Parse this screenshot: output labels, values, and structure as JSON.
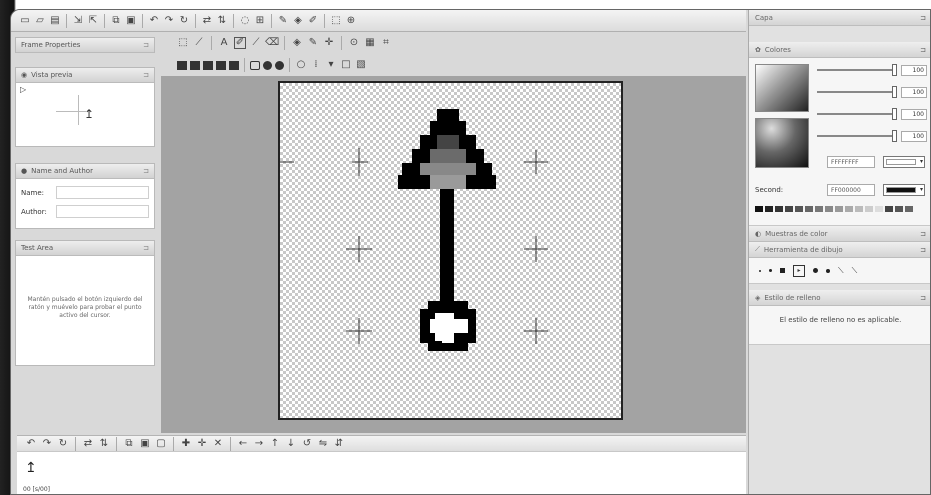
{
  "toolbar": {
    "icons": [
      "new-icon",
      "open-icon",
      "save-icon",
      "import-icon",
      "export-icon",
      "copy-icon",
      "paste-icon",
      "undo-icon",
      "redo-icon",
      "rotate-icon",
      "flip-icon",
      "mirror-icon",
      "lasso-icon",
      "grid-icon",
      "eyedropper-icon",
      "fill-icon",
      "pencil-icon",
      "select-icon",
      "zoom-icon"
    ]
  },
  "left": {
    "frame_props": {
      "title": "Frame Properties"
    },
    "preview": {
      "title": "Vista previa"
    },
    "name_author": {
      "title": "Name and Author",
      "name_label": "Name:",
      "author_label": "Author:",
      "name_value": "",
      "author_value": ""
    },
    "test_area": {
      "title": "Test Area",
      "hint": "Mantén pulsado el botón izquierdo del ratón y muévelo para probar el punto activo del cursor."
    }
  },
  "right": {
    "capa_title": "Capa",
    "colores_title": "Colores",
    "sliders": [
      "100",
      "100",
      "100",
      "100"
    ],
    "primary_hex": "FFFFFFFF",
    "second_label": "Second:",
    "second_hex": "FF000000",
    "palette": [
      "#111111",
      "#222222",
      "#333333",
      "#444444",
      "#555555",
      "#666666",
      "#777777",
      "#888888",
      "#999999",
      "#aaaaaa",
      "#bbbbbb",
      "#cccccc",
      "#dddddd",
      "#444444",
      "#555555",
      "#666666"
    ],
    "muestras_title": "Muestras de color",
    "herramienta_title": "Herramienta de dibujo",
    "relleno_title": "Estilo de relleno",
    "relleno_text": "El estilo de relleno no es aplicable."
  },
  "canvas": {
    "accent": "#000000"
  },
  "bottom": {
    "frame_label": "00 [s/00]"
  }
}
